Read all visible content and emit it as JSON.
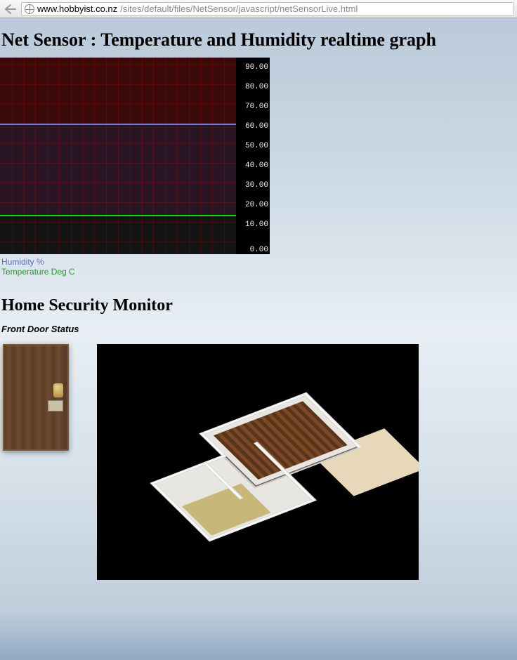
{
  "browser": {
    "url_domain": "www.hobbyist.co.nz",
    "url_path": "/sites/default/files/NetSensor/javascript/netSensorLive.html"
  },
  "titles": {
    "main": "Net Sensor : Temperature and Humidity realtime graph",
    "security": "Home Security Monitor",
    "door_status": "Front Door Status"
  },
  "legend": {
    "humidity": "Humidity %",
    "temperature": "Temperature Deg C"
  },
  "chart_data": {
    "type": "line",
    "ylabel": "",
    "xlabel": "",
    "ylim": [
      0,
      90
    ],
    "yticks": [
      "90.00",
      "80.00",
      "70.00",
      "60.00",
      "50.00",
      "40.00",
      "30.00",
      "20.00",
      "10.00",
      "0.00"
    ],
    "series": [
      {
        "name": "Humidity %",
        "color": "#6a7fe0",
        "approx_value": 63
      },
      {
        "name": "Temperature Deg C",
        "color": "#00e800",
        "approx_value": 18
      }
    ]
  }
}
